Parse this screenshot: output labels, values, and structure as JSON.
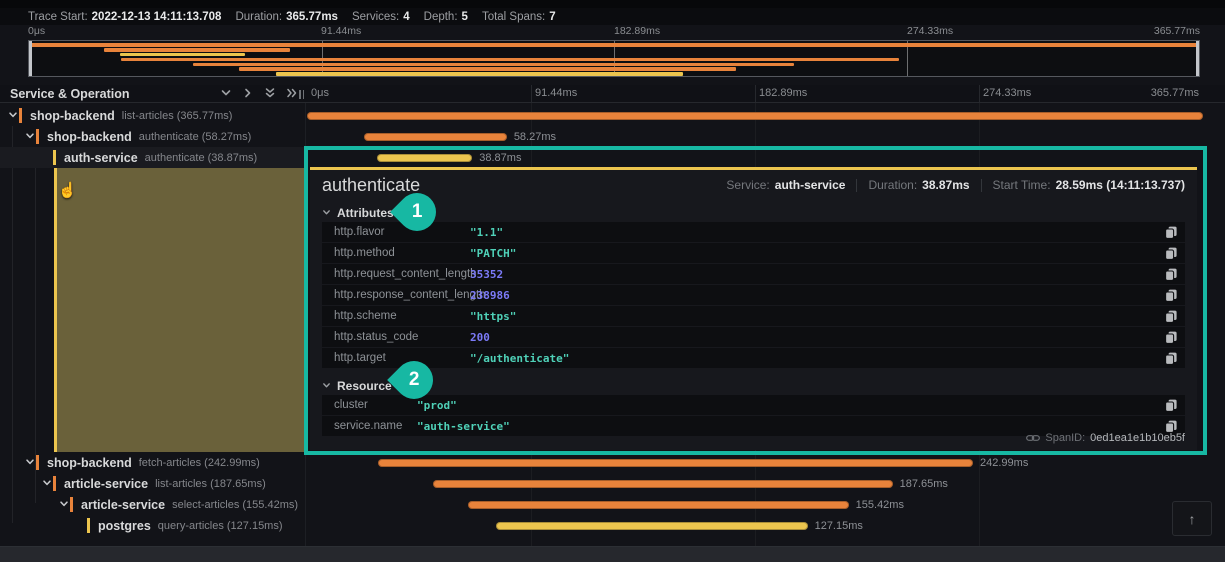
{
  "trace_header": {
    "items": [
      {
        "label": "Trace Start:",
        "value": "2022-12-13 14:11:13.708"
      },
      {
        "label": "Duration:",
        "value": "365.77ms"
      },
      {
        "label": "Services:",
        "value": "4"
      },
      {
        "label": "Depth:",
        "value": "5"
      },
      {
        "label": "Total Spans:",
        "value": "7"
      }
    ]
  },
  "timeline": {
    "duration_ms": 365.77,
    "ticks": [
      "0μs",
      "91.44ms",
      "182.89ms",
      "274.33ms",
      "365.77ms"
    ]
  },
  "tree": {
    "header": "Service & Operation"
  },
  "spans": [
    {
      "service": "shop-backend",
      "operation": "list-articles",
      "suffix": "(365.77ms)",
      "start_ms": 0,
      "duration_ms": 365.77,
      "depth": 0,
      "color": "#e8833b",
      "expandable": true,
      "bar_label": "",
      "selected": false
    },
    {
      "service": "shop-backend",
      "operation": "authenticate",
      "suffix": "(58.27ms)",
      "start_ms": 23.3,
      "duration_ms": 58.27,
      "depth": 1,
      "color": "#e8833b",
      "expandable": true,
      "bar_label": "58.27ms",
      "selected": false
    },
    {
      "service": "auth-service",
      "operation": "authenticate",
      "suffix": "(38.87ms)",
      "start_ms": 28.59,
      "duration_ms": 38.87,
      "depth": 2,
      "color": "#ecc54e",
      "expandable": false,
      "bar_label": "38.87ms",
      "selected": true
    },
    {
      "service": "shop-backend",
      "operation": "fetch-articles",
      "suffix": "(242.99ms)",
      "start_ms": 28.9,
      "duration_ms": 242.99,
      "depth": 1,
      "color": "#e8833b",
      "expandable": true,
      "bar_label": "242.99ms",
      "selected": false
    },
    {
      "service": "article-service",
      "operation": "list-articles",
      "suffix": "(187.65ms)",
      "start_ms": 51.4,
      "duration_ms": 187.65,
      "depth": 2,
      "color": "#e8833b",
      "expandable": true,
      "bar_label": "187.65ms",
      "selected": false
    },
    {
      "service": "article-service",
      "operation": "select-articles",
      "suffix": "(155.42ms)",
      "start_ms": 65.7,
      "duration_ms": 155.42,
      "depth": 3,
      "color": "#e8833b",
      "expandable": true,
      "bar_label": "155.42ms",
      "selected": false
    },
    {
      "service": "postgres",
      "operation": "query-articles",
      "suffix": "(127.15ms)",
      "start_ms": 77.2,
      "duration_ms": 127.15,
      "depth": 4,
      "color": "#ecc54e",
      "expandable": false,
      "bar_label": "127.15ms",
      "selected": false
    }
  ],
  "detail": {
    "title": "authenticate",
    "meta": [
      {
        "label": "Service:",
        "value": "auth-service"
      },
      {
        "label": "Duration:",
        "value": "38.87ms"
      },
      {
        "label": "Start Time:",
        "value": "28.59ms (14:11:13.737)"
      }
    ],
    "sections": [
      {
        "name": "Attributes",
        "rows": [
          {
            "key": "http.flavor",
            "value": "\"1.1\"",
            "kind": "string"
          },
          {
            "key": "http.method",
            "value": "\"PATCH\"",
            "kind": "string"
          },
          {
            "key": "http.request_content_length",
            "value": "35352",
            "kind": "number"
          },
          {
            "key": "http.response_content_length",
            "value": "238986",
            "kind": "number"
          },
          {
            "key": "http.scheme",
            "value": "\"https\"",
            "kind": "string"
          },
          {
            "key": "http.status_code",
            "value": "200",
            "kind": "number"
          },
          {
            "key": "http.target",
            "value": "\"/authenticate\"",
            "kind": "string"
          }
        ]
      },
      {
        "name": "Resource",
        "rows": [
          {
            "key": "cluster",
            "value": "\"prod\"",
            "kind": "string"
          },
          {
            "key": "service.name",
            "value": "\"auth-service\"",
            "kind": "string"
          }
        ]
      }
    ],
    "footer": {
      "span_id_label": "SpanID:",
      "span_id": "0ed1ea1e1b10eb5f"
    }
  },
  "annotations": {
    "color": "#17b8a3",
    "callouts": [
      {
        "number": "1"
      },
      {
        "number": "2"
      }
    ]
  },
  "misc": {
    "scroll_top": "↑",
    "cursor": "☝"
  },
  "colors": {
    "orange_span": "#e8833b",
    "yellow_span": "#ecc54e",
    "string_value": "#4fd1b8",
    "number_value": "#7b7af7",
    "annotation_teal": "#17b8a3",
    "selection_olive": "#6a613a"
  }
}
